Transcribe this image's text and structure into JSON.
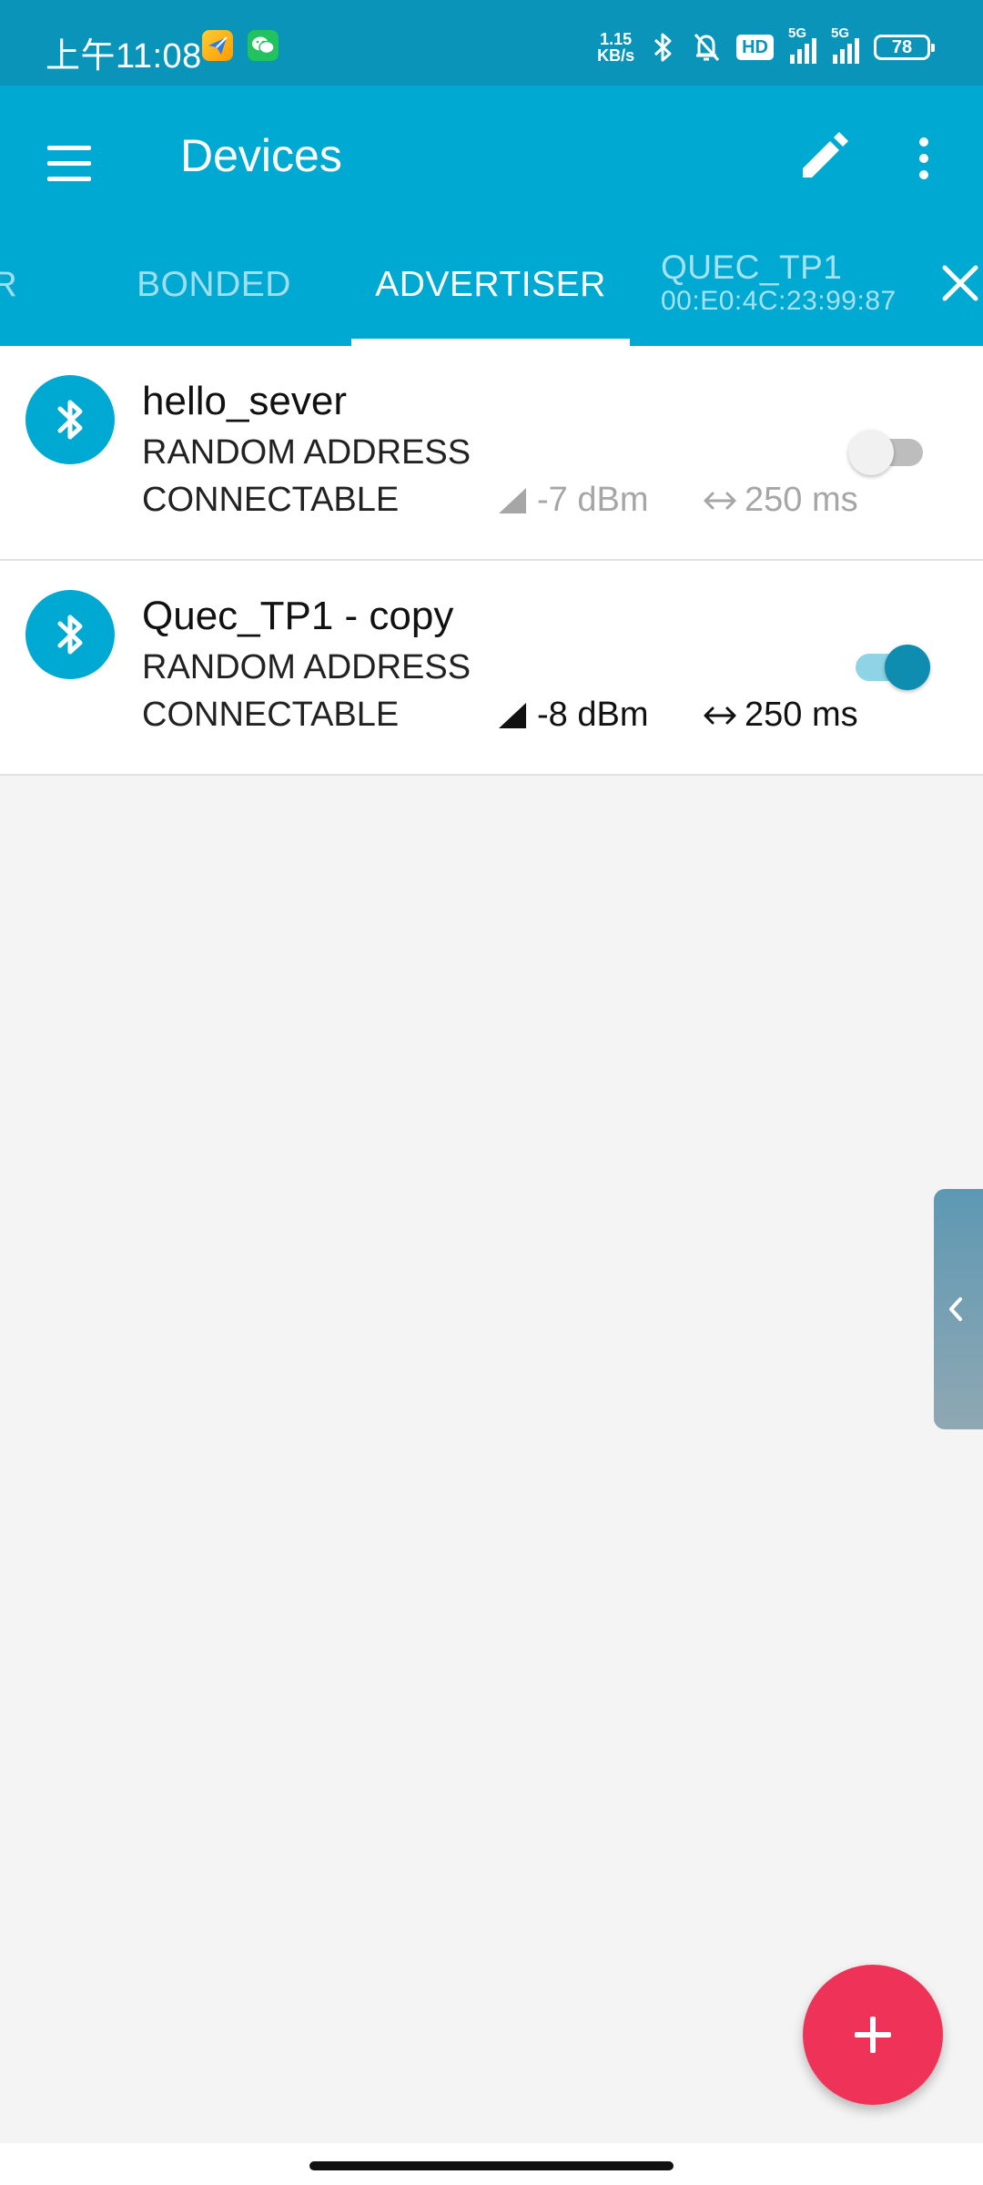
{
  "status_bar": {
    "time": "上午11:08",
    "net_speed_value": "1.15",
    "net_speed_unit": "KB/s",
    "hd_badge": "HD",
    "signal1_label": "5G",
    "signal2_label": "5G",
    "battery": "78"
  },
  "app_bar": {
    "title": "Devices",
    "icons": [
      "menu-icon",
      "edit-icon",
      "more-vert-icon"
    ]
  },
  "tabs": {
    "partial_label": "R",
    "bonded_label": "BONDED",
    "advertiser_label": "ADVERTISER",
    "device_name": "QUEC_TP1",
    "device_address": "00:E0:4C:23:99:87",
    "active": "ADVERTISER"
  },
  "advertisers": [
    {
      "name": "hello_sever",
      "address_type": "RANDOM ADDRESS",
      "connectable": "CONNECTABLE",
      "rssi": "-7 dBm",
      "interval": "250 ms",
      "enabled": false
    },
    {
      "name": "Quec_TP1 - copy",
      "address_type": "RANDOM ADDRESS",
      "connectable": "CONNECTABLE",
      "rssi": "-8 dBm",
      "interval": "250 ms",
      "enabled": true
    }
  ],
  "colors": {
    "status_bar": "#0a94ba",
    "app_bar": "#00a9d1",
    "fab": "#ef3358",
    "toggle_on": "#0e8db0"
  }
}
